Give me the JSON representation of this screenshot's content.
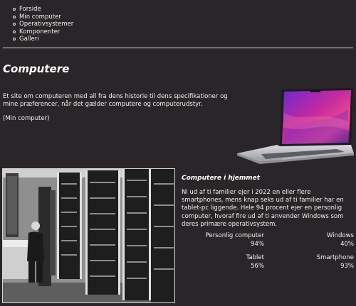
{
  "nav": {
    "items": [
      {
        "label": "Forside"
      },
      {
        "label": "Min computer"
      },
      {
        "label": "Operativsystemer"
      },
      {
        "label": "Komponenter"
      },
      {
        "label": "Galleri"
      }
    ]
  },
  "hero": {
    "title": "Computere",
    "intro": "Et site om computeren med all fra dens historie til dens specifikationer og mine præferencer, når det gælder computere og computerudstyr.",
    "link": "(Min computer)"
  },
  "home": {
    "heading": "Computere i hjemmet",
    "paragraph": "Ni ud af ti familier ejer i 2022 en eller flere smartphones, mens knap seks ud af ti familier har en tablet-pc liggende. Hele 94 procent ejer en personlig computer, hvoraf fire ud af ti anvender Windows som deres primære operativsystem.",
    "stats": [
      {
        "label": "Personlig computer",
        "value": "94%"
      },
      {
        "label": "Windows",
        "value": "40%"
      },
      {
        "label": "Tablet",
        "value": "56%"
      },
      {
        "label": "Smartphone",
        "value": "93%"
      }
    ]
  },
  "colors": {
    "background": "#2a2528",
    "text": "#f2f2f2",
    "divider": "#dcdcdc",
    "screen_accent": "#c42a9e"
  }
}
